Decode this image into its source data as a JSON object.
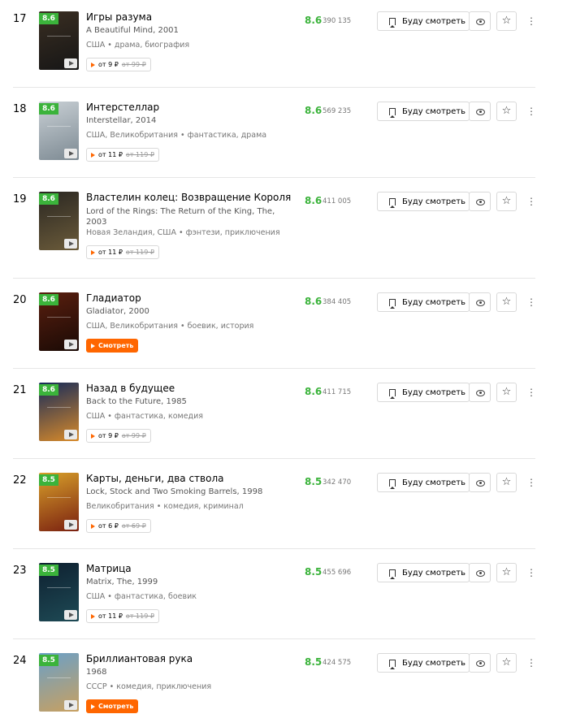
{
  "labels": {
    "watchlist": "Буду смотреть",
    "watch_now": "Смотреть"
  },
  "colors": {
    "rating_green": "#3bb33b",
    "accent_orange": "#ff6600"
  },
  "movies": [
    {
      "position": "17",
      "badge": "8.6",
      "title": "Игры разума",
      "original": "A Beautiful Mind, 2001",
      "meta": "США • драма, биография",
      "price": "от 9 ₽",
      "old_price": "от 99 ₽",
      "score": "8.6",
      "votes": "390 135",
      "poster": [
        "#3a2e22",
        "#161616"
      ]
    },
    {
      "position": "18",
      "badge": "8.6",
      "title": "Интерстеллар",
      "original": "Interstellar, 2014",
      "meta": "США, Великобритания • фантастика, драма",
      "price": "от 11 ₽",
      "old_price": "от 119 ₽",
      "score": "8.6",
      "votes": "569 235",
      "poster": [
        "#c9d0d5",
        "#7d8a93"
      ]
    },
    {
      "position": "19",
      "badge": "8.6",
      "title": "Властелин колец: Возвращение Короля",
      "original": "Lord of the Rings: The Return of the King, The, 2003",
      "meta": "Новая Зеландия, США • фэнтези, приключения",
      "price": "от 11 ₽",
      "old_price": "от 119 ₽",
      "score": "8.6",
      "votes": "411 005",
      "poster": [
        "#2a2722",
        "#6b5b3a"
      ]
    },
    {
      "position": "20",
      "badge": "8.6",
      "title": "Гладиатор",
      "original": "Gladiator, 2000",
      "meta": "США, Великобритания • боевик, история",
      "watch": true,
      "score": "8.6",
      "votes": "384 405",
      "poster": [
        "#5a1f0f",
        "#1a0a05"
      ]
    },
    {
      "position": "21",
      "badge": "8.6",
      "title": "Назад в будущее",
      "original": "Back to the Future, 1985",
      "meta": "США • фантастика, комедия",
      "price": "от 9 ₽",
      "old_price": "от 99 ₽",
      "score": "8.6",
      "votes": "411 715",
      "poster": [
        "#152a5a",
        "#d88a2a"
      ]
    },
    {
      "position": "22",
      "badge": "8.5",
      "title": "Карты, деньги, два ствола",
      "original": "Lock, Stock and Two Smoking Barrels, 1998",
      "meta": "Великобритания • комедия, криминал",
      "price": "от 6 ₽",
      "old_price": "от 69 ₽",
      "score": "8.5",
      "votes": "342 470",
      "poster": [
        "#d8a02a",
        "#7a2010"
      ]
    },
    {
      "position": "23",
      "badge": "8.5",
      "title": "Матрица",
      "original": "Matrix, The, 1999",
      "meta": "США • фантастика, боевик",
      "price": "от 11 ₽",
      "old_price": "от 119 ₽",
      "score": "8.5",
      "votes": "455 696",
      "poster": [
        "#0e2030",
        "#1e4a55"
      ]
    },
    {
      "position": "24",
      "badge": "8.5",
      "title": "Бриллиантовая рука",
      "original": "1968",
      "meta": "СССР • комедия, приключения",
      "watch": true,
      "score": "8.5",
      "votes": "424 575",
      "poster": [
        "#6aa0c8",
        "#c8a060"
      ]
    }
  ]
}
